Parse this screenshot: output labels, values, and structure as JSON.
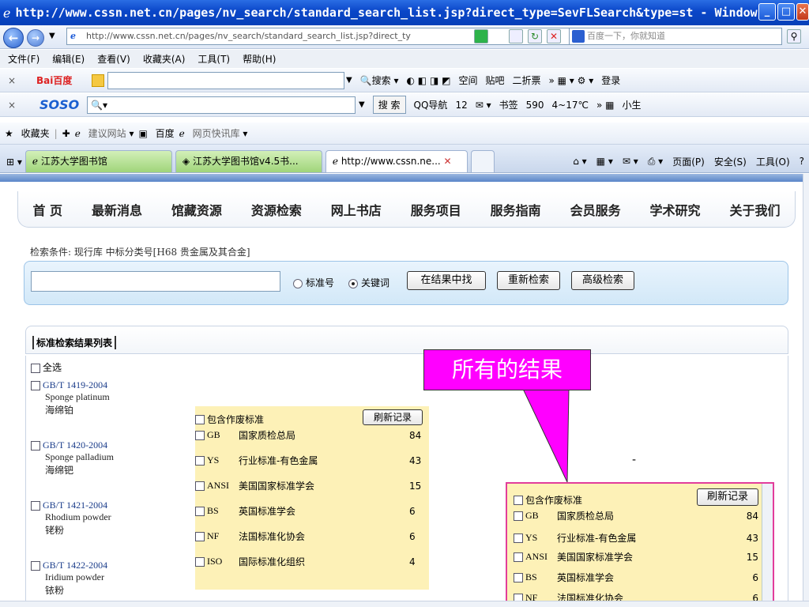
{
  "window": {
    "title": "http://www.cssn.net.cn/pages/nv_search/standard_search_list.jsp?direct_type=SevFLSearch&type=st - Windows In..."
  },
  "addressbar": {
    "url": "http://www.cssn.net.cn/pages/nv_search/standard_search_list.jsp?direct_ty",
    "search_text": "百度一下，你就知道"
  },
  "menubar": [
    "文件(F)",
    "编辑(E)",
    "查看(V)",
    "收藏夹(A)",
    "工具(T)",
    "帮助(H)"
  ],
  "baidu_toolbar": {
    "logo": "Bai百度",
    "search_label": "搜索",
    "items": [
      "空间",
      "贴吧",
      "二折票",
      "登录"
    ]
  },
  "soso_toolbar": {
    "logo": "SOSO",
    "search_label": "搜 索",
    "items": [
      "QQ导航",
      "12",
      "书签",
      "590",
      "4~17℃",
      "小生"
    ]
  },
  "favorites_bar": {
    "label": "收藏夹",
    "items": [
      "建议网站",
      "百度",
      "网页快讯库"
    ]
  },
  "tabs": [
    {
      "label": "江苏大学图书馆"
    },
    {
      "label": "江苏大学图书馆v4.5书..."
    },
    {
      "label": "http://www.cssn.ne..."
    }
  ],
  "tab_tools": [
    "页面(P)",
    "安全(S)",
    "工具(O)"
  ],
  "site_nav": [
    "首 页",
    "最新消息",
    "馆藏资源",
    "资源检索",
    "网上书店",
    "服务项目",
    "服务指南",
    "会员服务",
    "学术研究",
    "关于我们"
  ],
  "search": {
    "criteria": "检索条件: 现行库 中标分类号[H68 贵金属及其合金]",
    "keyword_value": "",
    "radio_std_no": "标准号",
    "radio_keyword": "关键词",
    "btn_in_results": "在结果中找",
    "btn_research": "重新检索",
    "btn_advanced": "高级检索"
  },
  "results": {
    "title": "标准检索结果列表",
    "select_all": "全选",
    "items": [
      {
        "code": "GB/T 1419-2004",
        "en": "Sponge platinum",
        "zh": "海绵铂"
      },
      {
        "code": "GB/T 1420-2004",
        "en": "Sponge palladium",
        "zh": "海绵钯"
      },
      {
        "code": "GB/T 1421-2004",
        "en": "Rhodium powder",
        "zh": "铑粉"
      },
      {
        "code": "GB/T 1422-2004",
        "en": "Iridium powder",
        "zh": "铱粉"
      }
    ]
  },
  "filter": {
    "include_label": "包含作废标准",
    "refresh_label": "刷新记录",
    "rows": [
      {
        "code": "GB",
        "name": "国家质检总局",
        "count": "84"
      },
      {
        "code": "YS",
        "name": "行业标准-有色金属",
        "count": "43"
      },
      {
        "code": "ANSI",
        "name": "美国国家标准学会",
        "count": "15"
      },
      {
        "code": "BS",
        "name": "英国标准学会",
        "count": "6"
      },
      {
        "code": "NF",
        "name": "法国标准化协会",
        "count": "6"
      },
      {
        "code": "ISO",
        "name": "国际标准化组织",
        "count": "4"
      }
    ]
  },
  "annotation": {
    "callout_text": "所有的结果",
    "callout_color": "#ff00ff"
  }
}
